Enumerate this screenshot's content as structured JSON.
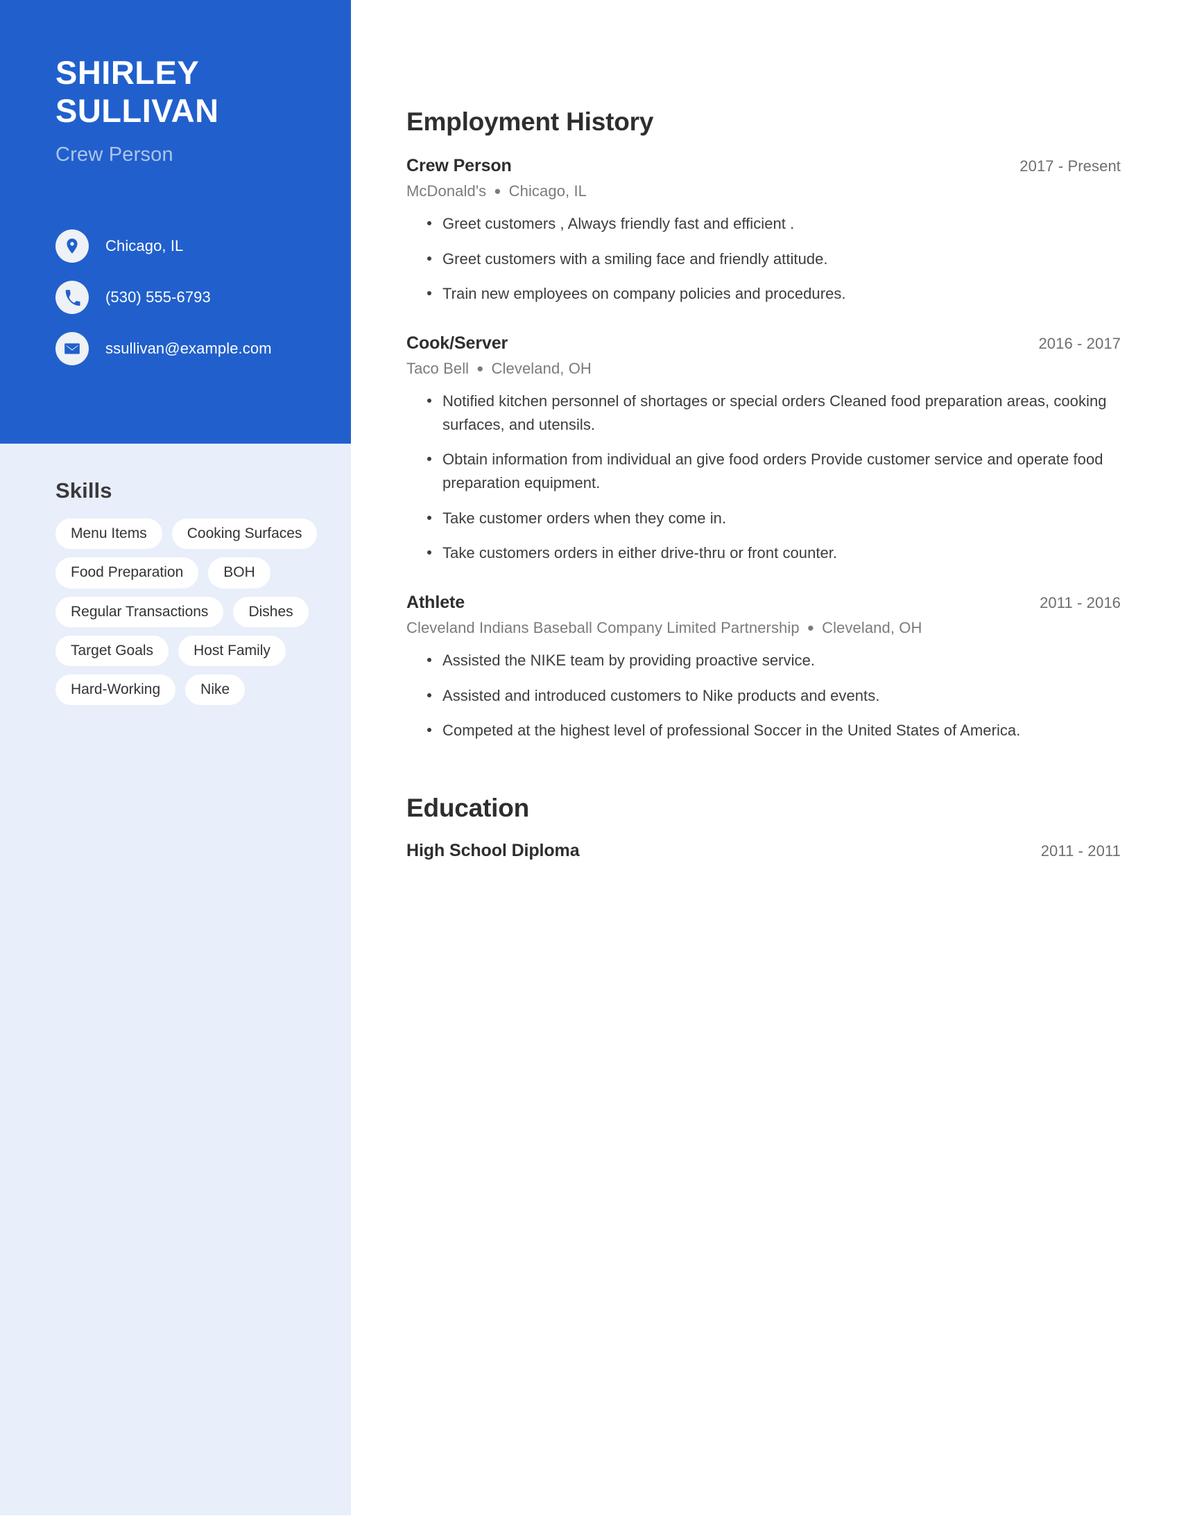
{
  "profile": {
    "first_name": "SHIRLEY",
    "last_name": "SULLIVAN",
    "job_title": "Crew Person"
  },
  "theme": {
    "accent": "#2160cc",
    "sidebar_bg": "#e8eefa",
    "subtitle": "#aec4ec",
    "chip_bg": "#ffffff",
    "text_dark": "#2e2e2e",
    "text_muted": "#7b7b7b"
  },
  "contacts": [
    {
      "icon": "location-pin-icon",
      "value": "Chicago, IL"
    },
    {
      "icon": "phone-icon",
      "value": "(530) 555-6793"
    },
    {
      "icon": "envelope-icon",
      "value": "ssullivan@example.com"
    }
  ],
  "skills": {
    "heading": "Skills",
    "items": [
      "Menu Items",
      "Cooking Surfaces",
      "Food Preparation",
      "BOH",
      "Regular Transactions",
      "Dishes",
      "Target Goals",
      "Host Family",
      "Hard-Working",
      "Nike"
    ]
  },
  "employment": {
    "heading": "Employment History",
    "entries": [
      {
        "role": "Crew Person",
        "date": "2017 - Present",
        "company": "McDonald's",
        "location": "Chicago, IL",
        "separator": "●",
        "bullets": [
          "Greet customers , Always friendly fast and efficient .",
          "Greet customers with a smiling face and friendly attitude.",
          "Train new employees on company policies and procedures."
        ]
      },
      {
        "role": "Cook/Server",
        "date": "2016 - 2017",
        "company": "Taco Bell",
        "location": "Cleveland, OH",
        "separator": "●",
        "bullets": [
          "Notified kitchen personnel of shortages or special orders Cleaned food preparation areas, cooking surfaces, and utensils.",
          "Obtain information from individual an give food orders Provide customer service and operate food preparation equipment.",
          "Take customer orders when they come in.",
          "Take customers orders in either drive-thru or front counter."
        ]
      },
      {
        "role": "Athlete",
        "date": "2011 - 2016",
        "company": "Cleveland Indians Baseball Company Limited Partnership",
        "location": "Cleveland, OH",
        "separator": "●",
        "bullets": [
          "Assisted the NIKE team by providing proactive service.",
          "Assisted and introduced customers to Nike products and events.",
          "Competed at the highest level of professional Soccer in the United States of America."
        ]
      }
    ]
  },
  "education": {
    "heading": "Education",
    "entries": [
      {
        "degree": "High School Diploma",
        "date": "2011 - 2011"
      }
    ]
  }
}
